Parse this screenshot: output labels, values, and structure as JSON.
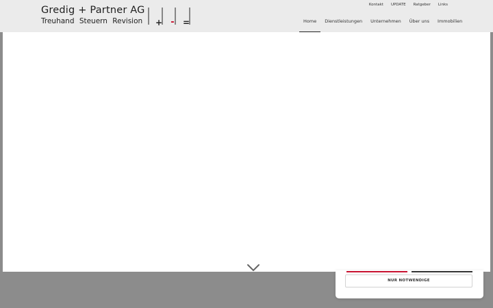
{
  "logo": {
    "name": "Gredig + Partner AG",
    "tagline": "Treuhand  Steuern  Revision",
    "mark_plus": "+",
    "mark_minus": "-",
    "mark_equals": "=",
    "accent_color": "#c8102e"
  },
  "top_links": [
    {
      "label": "Kontakt"
    },
    {
      "label": "UPDATE"
    },
    {
      "label": "Ratgeber"
    },
    {
      "label": "Links"
    }
  ],
  "nav": [
    {
      "label": "Home",
      "active": true
    },
    {
      "label": "Dienstleistungen"
    },
    {
      "label": "Unternehmen"
    },
    {
      "label": "Über uns"
    },
    {
      "label": "Immobilien"
    }
  ],
  "scroll_icon": "chevron-down-icon",
  "cookie": {
    "necessary_label": "NUR NOTWENDIGE"
  }
}
